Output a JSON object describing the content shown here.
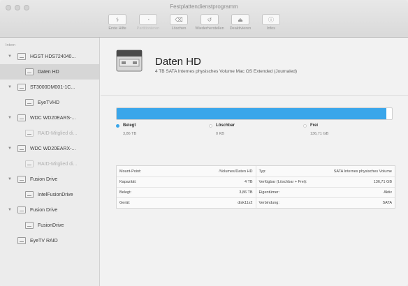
{
  "window": {
    "title": "Festplattendienstprogramm"
  },
  "toolbar": {
    "items": [
      {
        "label": "Erste Hilfe",
        "icon": "stethoscope-icon",
        "glyph": "⚕",
        "disabled": false
      },
      {
        "label": "Partitionieren",
        "icon": "partition-icon",
        "glyph": "◔",
        "disabled": true
      },
      {
        "label": "Löschen",
        "icon": "erase-icon",
        "glyph": "⌫",
        "disabled": false
      },
      {
        "label": "Wiederherstellen",
        "icon": "restore-icon",
        "glyph": "↺",
        "disabled": false
      },
      {
        "label": "Deaktivieren",
        "icon": "eject-icon",
        "glyph": "⏏",
        "disabled": false
      },
      {
        "label": "Infos",
        "icon": "info-icon",
        "glyph": "ⓘ",
        "disabled": false
      }
    ]
  },
  "sidebar": {
    "section": "Intern",
    "items": [
      {
        "label": "HGST HDS724040...",
        "level": 0,
        "expanded": true,
        "selected": false,
        "dim": false
      },
      {
        "label": "Daten HD",
        "level": 1,
        "selected": true,
        "dim": false
      },
      {
        "label": "ST3000DM001-1C...",
        "level": 0,
        "expanded": true,
        "selected": false,
        "dim": false
      },
      {
        "label": "EyeTVHD",
        "level": 1,
        "selected": false,
        "dim": false
      },
      {
        "label": "WDC WD20EARS-...",
        "level": 0,
        "expanded": true,
        "selected": false,
        "dim": false
      },
      {
        "label": "RAID-Mitglied di...",
        "level": 1,
        "selected": false,
        "dim": true
      },
      {
        "label": "WDC WD20EARX-...",
        "level": 0,
        "expanded": true,
        "selected": false,
        "dim": false
      },
      {
        "label": "RAID-Mitglied di...",
        "level": 1,
        "selected": false,
        "dim": true
      },
      {
        "label": "Fusion Drive",
        "level": 0,
        "expanded": true,
        "selected": false,
        "dim": false
      },
      {
        "label": "IntelFusionDrive",
        "level": 1,
        "selected": false,
        "dim": false
      },
      {
        "label": "Fusion Drive",
        "level": 0,
        "expanded": true,
        "selected": false,
        "dim": false
      },
      {
        "label": "FusionDrive",
        "level": 1,
        "selected": false,
        "dim": false
      },
      {
        "label": "EyeTV RAID",
        "level": 0,
        "expanded": false,
        "selected": false,
        "dim": false
      }
    ]
  },
  "volume": {
    "name": "Daten HD",
    "description": "4 TB SATA Internes physisches Volume Mac OS Extended (Journaled)"
  },
  "usage": {
    "used_fraction": 0.98,
    "colors": {
      "used": "#3aa6ea",
      "purgeable": "#ffffff",
      "free": "#ffffff"
    },
    "legend": [
      {
        "label": "Belegt",
        "value": "3,86 TB",
        "color": "#3aa6ea"
      },
      {
        "label": "Löschbar",
        "value": "0 KB",
        "color": "#ffffff"
      },
      {
        "label": "Frei",
        "value": "136,71 GB",
        "color": "#ffffff"
      }
    ]
  },
  "info": {
    "rows": [
      [
        {
          "k": "Mount-Point:",
          "v": "/Volumes/Daten HD"
        },
        {
          "k": "Typ:",
          "v": "SATA Internes physisches Volume"
        }
      ],
      [
        {
          "k": "Kapazität:",
          "v": "4 TB"
        },
        {
          "k": "Verfügbar (Löschbar + Frei):",
          "v": "136,71 GB"
        }
      ],
      [
        {
          "k": "Belegt:",
          "v": "3,86 TB"
        },
        {
          "k": "Eigentümer:",
          "v": "Aktiv"
        }
      ],
      [
        {
          "k": "Gerät:",
          "v": "disk11s2"
        },
        {
          "k": "Verbindung:",
          "v": "SATA"
        }
      ]
    ]
  }
}
